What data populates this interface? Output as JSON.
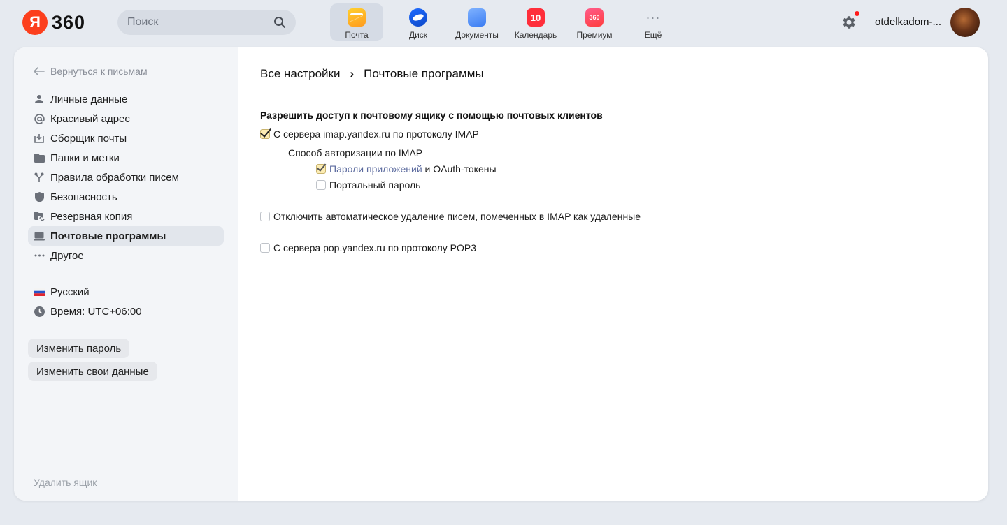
{
  "header": {
    "logo_text": "360",
    "logo_letter": "Я",
    "search_placeholder": "Поиск",
    "apps": [
      {
        "label": "Почта",
        "icon": "mail-icon",
        "active": true
      },
      {
        "label": "Диск",
        "icon": "disk-icon"
      },
      {
        "label": "Документы",
        "icon": "documents-icon"
      },
      {
        "label": "Календарь",
        "icon": "calendar-icon",
        "badge": "10"
      },
      {
        "label": "Премиум",
        "icon": "premium-icon",
        "badge": "360"
      },
      {
        "label": "Ещё",
        "icon": "more-icon",
        "badge": "···"
      }
    ],
    "username": "otdelkadom-...",
    "notification_color": "#ff1a1a"
  },
  "sidebar": {
    "back_label": "Вернуться к письмам",
    "items": [
      {
        "label": "Личные данные",
        "icon": "person-icon"
      },
      {
        "label": "Красивый адрес",
        "icon": "at-sign-icon"
      },
      {
        "label": "Сборщик почты",
        "icon": "inbox-download-icon"
      },
      {
        "label": "Папки и метки",
        "icon": "folder-icon"
      },
      {
        "label": "Правила обработки писем",
        "icon": "rules-fork-icon"
      },
      {
        "label": "Безопасность",
        "icon": "shield-icon"
      },
      {
        "label": "Резервная копия",
        "icon": "backup-folder-icon"
      },
      {
        "label": "Почтовые программы",
        "icon": "laptop-icon",
        "active": true
      },
      {
        "label": "Другое",
        "icon": "dots-icon"
      }
    ],
    "language": "Русский",
    "timezone": "Время: UTC+06:00",
    "change_password": "Изменить пароль",
    "change_data": "Изменить свои данные",
    "delete_box": "Удалить ящик"
  },
  "content": {
    "breadcrumb_root": "Все настройки",
    "breadcrumb_sep": "›",
    "breadcrumb_current": "Почтовые программы",
    "section_title": "Разрешить доступ к почтовому ящику с помощью почтовых клиентов",
    "imap_label": "С сервера imap.yandex.ru по протоколу IMAP",
    "imap_checked": true,
    "auth_title": "Способ авторизации по IMAP",
    "app_passwords_link": "Пароли приложений",
    "app_passwords_rest": " и OAuth-токены",
    "app_passwords_checked": true,
    "portal_password": "Портальный пароль",
    "portal_checked": false,
    "disable_autodelete": "Отключить автоматическое удаление писем, помеченных в IMAP как удаленные",
    "disable_autodelete_checked": false,
    "pop3_label": "С сервера pop.yandex.ru по протоколу POP3",
    "pop3_checked": false
  }
}
